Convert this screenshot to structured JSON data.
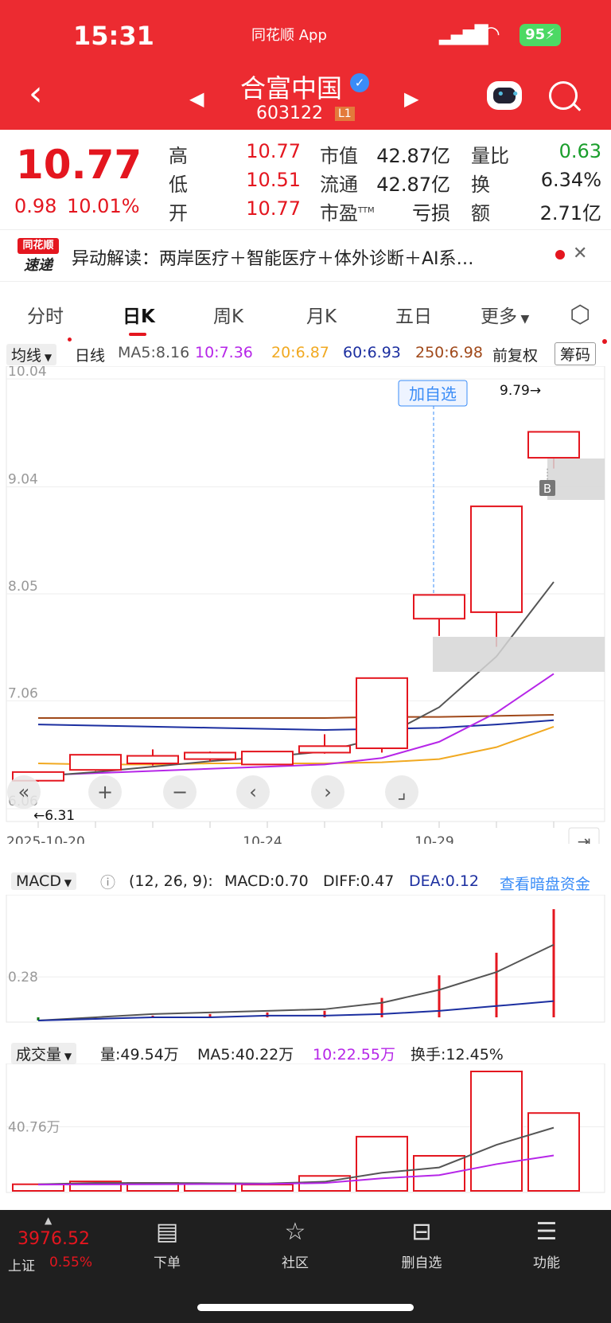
{
  "status_bar": {
    "time": "15:31",
    "app_label": "同花顺 App",
    "battery": "95"
  },
  "header": {
    "title": "合富中国",
    "code": "603122",
    "badge": "L1"
  },
  "quote": {
    "price": "10.77",
    "change": "0.98",
    "change_pct": "10.01%",
    "rows": [
      {
        "l1": "高",
        "v1": "10.77",
        "l2": "市值",
        "v2": "42.87亿",
        "l3": "量比",
        "v3": "0.63"
      },
      {
        "l1": "低",
        "v1": "10.51",
        "l2": "流通",
        "v2": "42.87亿",
        "l3": "换",
        "v3": "6.34%"
      },
      {
        "l1": "开",
        "v1": "10.77",
        "l2": "市盈",
        "l2sup": "TTM",
        "v2": "亏损",
        "l3": "额",
        "v3": "2.71亿"
      }
    ]
  },
  "news": {
    "logo_top": "同花顺",
    "logo_bottom": "速递",
    "text": "异动解读：两岸医疗＋智能医疗＋体外诊断＋AI系…"
  },
  "tabs": [
    "分时",
    "日K",
    "周K",
    "月K",
    "五日",
    "更多"
  ],
  "legend": {
    "type": "均线",
    "period": "日线",
    "ma5": "MA5:8.16",
    "ma10": "10:7.36",
    "ma20": "20:6.87",
    "ma60": "60:6.93",
    "ma250": "250:6.98",
    "adjust": "前复权",
    "chip": "筹码"
  },
  "kline": {
    "y_ticks": [
      "10.04",
      "9.04",
      "8.05",
      "7.06",
      "6.06"
    ],
    "high_label": "9.79→",
    "low_label": "←6.31",
    "add_label": "加自选",
    "b_marker": "B",
    "x_labels": [
      "2025-10-20",
      "10-24",
      "10-29"
    ]
  },
  "macd": {
    "name": "MACD",
    "params": "(12, 26, 9):",
    "macd": "MACD:0.70",
    "diff": "DIFF:0.47",
    "dea": "DEA:0.12",
    "link": "查看暗盘资金",
    "tick": "0.28"
  },
  "volume": {
    "name": "成交量",
    "vol": "量:49.54万",
    "ma5": "MA5:40.22万",
    "ma10": "10:22.55万",
    "turnover": "换手:12.45%",
    "tick": "40.76万"
  },
  "index": {
    "value": "3976.52",
    "name": "上证",
    "pct": "0.55%"
  },
  "nav": [
    "下单",
    "社区",
    "删自选",
    "功能"
  ],
  "colors": {
    "up": "#e4161f",
    "down": "#0e7a12",
    "header": "#ec2b31",
    "ma5": "#555555",
    "ma10": "#b626e8",
    "ma20": "#f1a921",
    "ma60": "#1c2fa0",
    "ma250": "#a0491a"
  },
  "chart_data": {
    "type": "candlestick",
    "categories": [
      "10-20",
      "10-21",
      "10-22",
      "10-23",
      "10-24",
      "10-27",
      "10-28",
      "10-29",
      "10-30",
      "10-31"
    ],
    "open": [
      6.32,
      6.42,
      6.48,
      6.52,
      6.47,
      6.58,
      6.62,
      7.82,
      7.88,
      9.31
    ],
    "close": [
      6.4,
      6.56,
      6.55,
      6.58,
      6.59,
      6.64,
      7.27,
      8.04,
      8.86,
      9.55
    ],
    "high": [
      6.4,
      6.56,
      6.61,
      6.59,
      6.59,
      6.75,
      7.27,
      8.04,
      8.86,
      9.55
    ],
    "low": [
      6.31,
      6.41,
      6.46,
      6.5,
      6.47,
      6.57,
      6.58,
      7.66,
      7.56,
      9.21
    ],
    "ma5": [
      6.36,
      6.4,
      6.45,
      6.5,
      6.54,
      6.59,
      6.72,
      7.0,
      7.47,
      8.16
    ],
    "ma10": [
      6.37,
      6.39,
      6.41,
      6.43,
      6.45,
      6.47,
      6.53,
      6.68,
      6.95,
      7.31
    ],
    "ma20": [
      6.48,
      6.47,
      6.47,
      6.48,
      6.48,
      6.48,
      6.49,
      6.52,
      6.63,
      6.82
    ],
    "ma60": [
      6.84,
      6.83,
      6.82,
      6.81,
      6.8,
      6.79,
      6.8,
      6.81,
      6.84,
      6.88
    ],
    "ma250": [
      6.9,
      6.9,
      6.9,
      6.9,
      6.9,
      6.9,
      6.91,
      6.91,
      6.92,
      6.93
    ],
    "ylim": [
      6.06,
      10.04
    ],
    "macd_hist": [
      0.01,
      0.02,
      0.04,
      0.05,
      0.06,
      0.07,
      0.15,
      0.29,
      0.43,
      0.7
    ],
    "macd_diff": [
      0.0,
      0.02,
      0.04,
      0.05,
      0.06,
      0.07,
      0.11,
      0.19,
      0.3,
      0.47
    ],
    "macd_dea": [
      0.0,
      0.01,
      0.02,
      0.02,
      0.03,
      0.03,
      0.04,
      0.06,
      0.09,
      0.12
    ],
    "macd_ylim": [
      0,
      0.74
    ],
    "volume": [
      4.2,
      6.0,
      5.0,
      4.5,
      4.0,
      9.5,
      34.5,
      22.3,
      76.0,
      49.54
    ],
    "vol_ma5": [
      4.2,
      5.0,
      5.0,
      4.9,
      4.7,
      5.8,
      11.5,
      14.9,
      29.3,
      40.22
    ],
    "vol_ma10": [
      4.0,
      4.1,
      4.2,
      4.3,
      4.4,
      5.0,
      8.0,
      10.0,
      17.0,
      22.55
    ],
    "vol_ylim": [
      0,
      76
    ]
  }
}
